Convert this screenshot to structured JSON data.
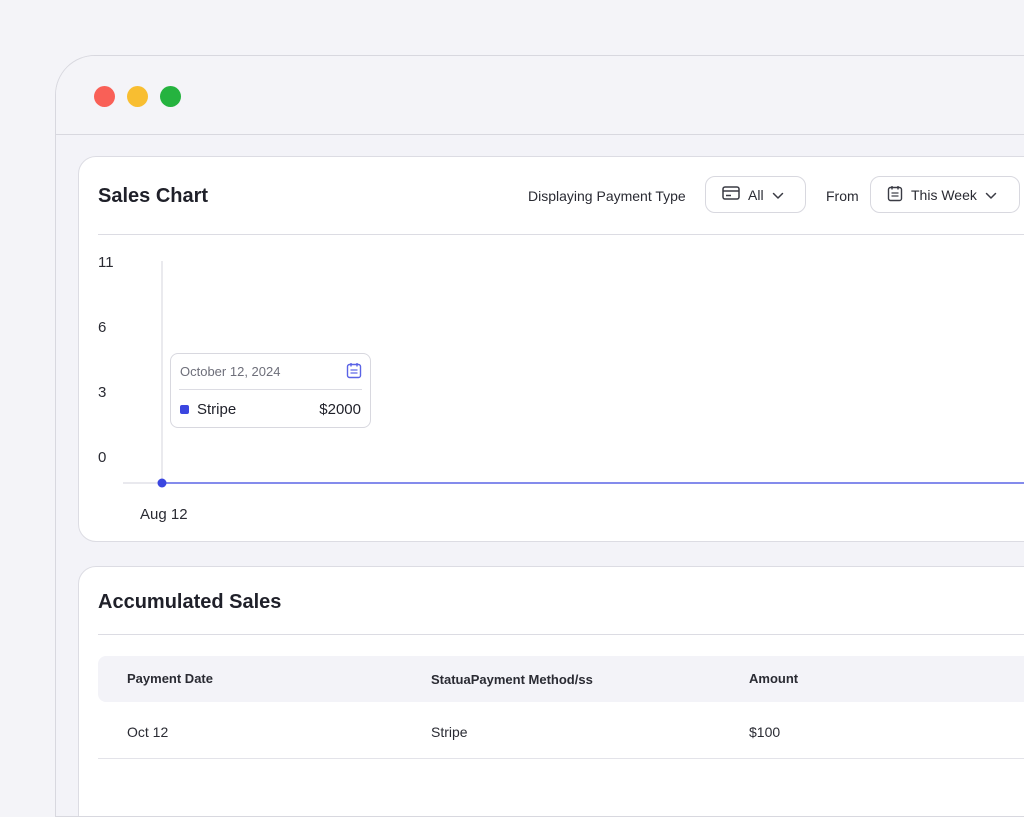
{
  "window": {
    "controls": [
      "close",
      "minimize",
      "maximize"
    ]
  },
  "sales_chart": {
    "title": "Sales Chart",
    "payment_filter": {
      "label": "Displaying Payment Type",
      "value": "All",
      "icon": "card-icon"
    },
    "date_filter": {
      "label": "From",
      "value": "This Week",
      "icon": "calendar-icon"
    },
    "tooltip": {
      "date": "October 12, 2024",
      "series": "Stripe",
      "value": "$2000",
      "swatch_color": "#3b46e0"
    }
  },
  "chart_data": {
    "type": "line",
    "x": [
      "Aug 12"
    ],
    "series": [
      {
        "name": "Stripe",
        "values": [
          0
        ],
        "color": "#3b46e0"
      }
    ],
    "y_ticks": [
      "11",
      "6",
      "3",
      "0"
    ],
    "x_ticks": [
      "Aug 12"
    ],
    "title": "",
    "xlabel": "",
    "ylabel": ""
  },
  "accumulated_sales": {
    "title": "Accumulated Sales",
    "columns": [
      "Payment Date",
      "StatuaPayment Method/ss",
      "Amount"
    ],
    "rows": [
      [
        "Oct 12",
        "Stripe",
        "$100"
      ]
    ]
  },
  "colors": {
    "accent": "#3b46e0",
    "border": "#dcdce3",
    "background": "#f4f4f8"
  }
}
